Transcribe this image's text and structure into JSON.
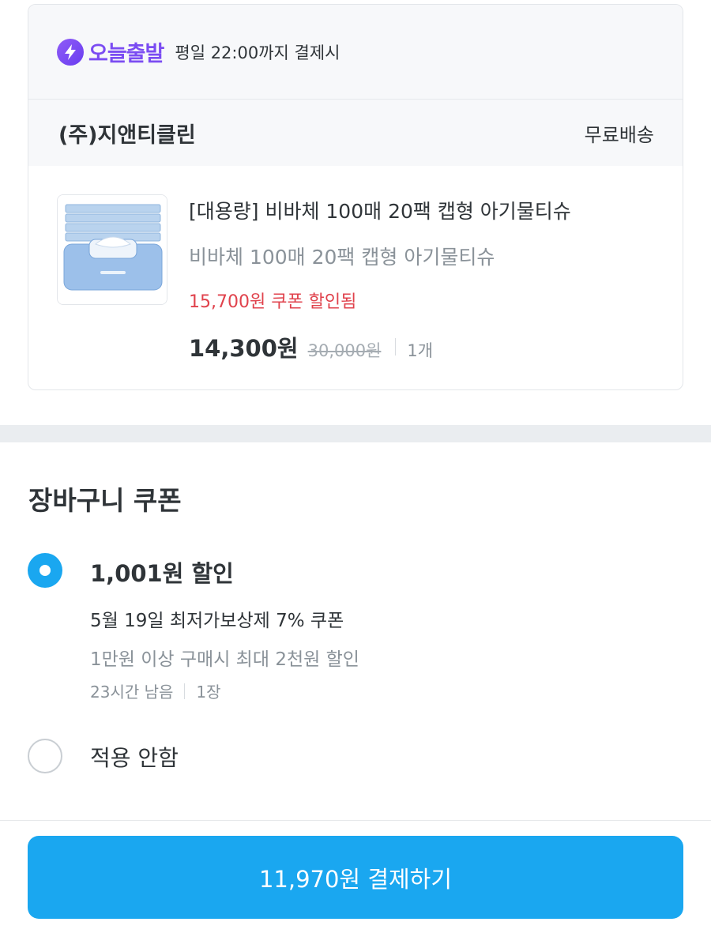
{
  "order": {
    "delivery_brand": "오늘출발",
    "delivery_note": "평일 22:00까지 결제시",
    "seller": "(주)지앤티클린",
    "shipping": "무료배송",
    "product": {
      "title": "[대용량] 비바체 100매 20팩 캡형 아기물티슈",
      "option": "비바체 100매 20팩 캡형 아기물티슈",
      "coupon_note": "15,700원 쿠폰 할인됨",
      "price": "14,300원",
      "original_price": "30,000원",
      "quantity": "1개"
    }
  },
  "coupon_section": {
    "title": "장바구니 쿠폰",
    "selected": {
      "amount": "1,001원 할인",
      "name": "5월 19일 최저가보상제 7% 쿠폰",
      "condition": "1만원 이상 구매시 최대 2천원 할인",
      "time_left": "23시간 남음",
      "count": "1장"
    },
    "none_label": "적용 안함"
  },
  "pay_button": "11,970원 결제하기",
  "colors": {
    "accent": "#1aa7f0",
    "brand_purple": "#7b4cf2",
    "discount_red": "#e0424c"
  }
}
